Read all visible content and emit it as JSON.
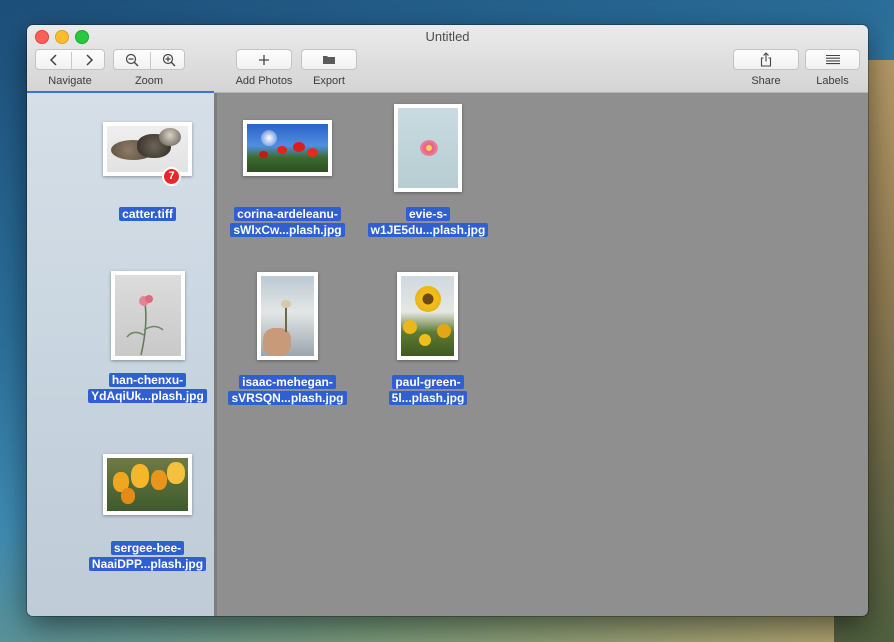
{
  "window": {
    "title": "Untitled"
  },
  "toolbar": {
    "navigate_label": "Navigate",
    "zoom_label": "Zoom",
    "add_photos_label": "Add Photos",
    "export_label": "Export",
    "share_label": "Share",
    "labels_label": "Labels"
  },
  "sidebar": {
    "items": [
      {
        "filename": "catter.tiff",
        "badge": "7"
      },
      {
        "filename": "han-chenxu-YdAqiUk...plash.jpg"
      },
      {
        "filename": "sergee-bee-NaaiDPP...plash.jpg"
      }
    ]
  },
  "main": {
    "items": [
      {
        "filename": "corina-ardeleanu-sWlxCw...plash.jpg"
      },
      {
        "filename": "evie-s-w1JE5du...plash.jpg"
      },
      {
        "filename": "isaac-mehegan-sVRSQN...plash.jpg"
      },
      {
        "filename": "paul-green-5l...plash.jpg"
      }
    ]
  },
  "colors": {
    "selection": "#2f5fd0",
    "badge": "#e8262c"
  }
}
